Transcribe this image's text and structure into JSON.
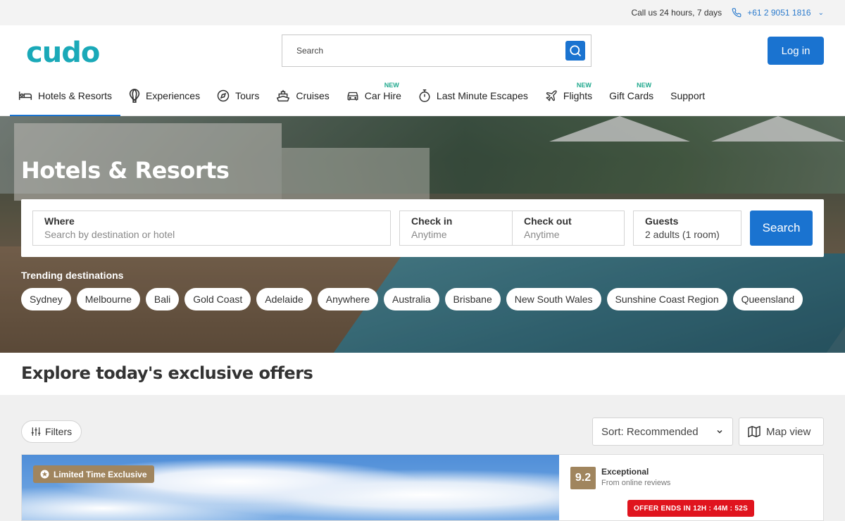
{
  "topbar": {
    "hours": "Call us 24 hours, 7 days",
    "phone": "+61 2 9051 1816"
  },
  "header": {
    "logo": "cudo",
    "search_placeholder": "Search",
    "login": "Log in"
  },
  "nav": {
    "items": [
      {
        "label": "Hotels & Resorts",
        "icon": "bed-icon"
      },
      {
        "label": "Experiences",
        "icon": "balloon-icon"
      },
      {
        "label": "Tours",
        "icon": "compass-icon"
      },
      {
        "label": "Cruises",
        "icon": "ship-icon"
      },
      {
        "label": "Car Hire",
        "icon": "car-icon",
        "badge": "NEW"
      },
      {
        "label": "Last Minute Escapes",
        "icon": "stopwatch-icon"
      },
      {
        "label": "Flights",
        "icon": "plane-icon",
        "badge": "NEW"
      },
      {
        "label": "Gift Cards",
        "badge": "NEW"
      },
      {
        "label": "Support"
      }
    ]
  },
  "hero": {
    "title": "Hotels & Resorts",
    "where_label": "Where",
    "where_placeholder": "Search by destination or hotel",
    "checkin_label": "Check in",
    "checkin_value": "Anytime",
    "checkout_label": "Check out",
    "checkout_value": "Anytime",
    "guests_label": "Guests",
    "guests_value": "2 adults (1 room)",
    "search_button": "Search",
    "trending_title": "Trending destinations",
    "trending": [
      "Sydney",
      "Melbourne",
      "Bali",
      "Gold Coast",
      "Adelaide",
      "Anywhere",
      "Australia",
      "Brisbane",
      "New South Wales",
      "Sunshine Coast Region",
      "Queensland"
    ]
  },
  "explore": {
    "title": "Explore today's exclusive offers"
  },
  "results": {
    "filters": "Filters",
    "sort": "Sort: Recommended",
    "map_view": "Map view",
    "card": {
      "badge": "Limited Time Exclusive",
      "score": "9.2",
      "score_label": "Exceptional",
      "score_sub": "From online reviews",
      "offer_ends": "OFFER ENDS IN 12H : 44M : 52S"
    }
  },
  "colors": {
    "primary": "#1a73d0",
    "logo": "#1aa9b8",
    "gold": "#a0855e",
    "new_badge": "#1fa88d",
    "offer_red": "#e0141e"
  }
}
